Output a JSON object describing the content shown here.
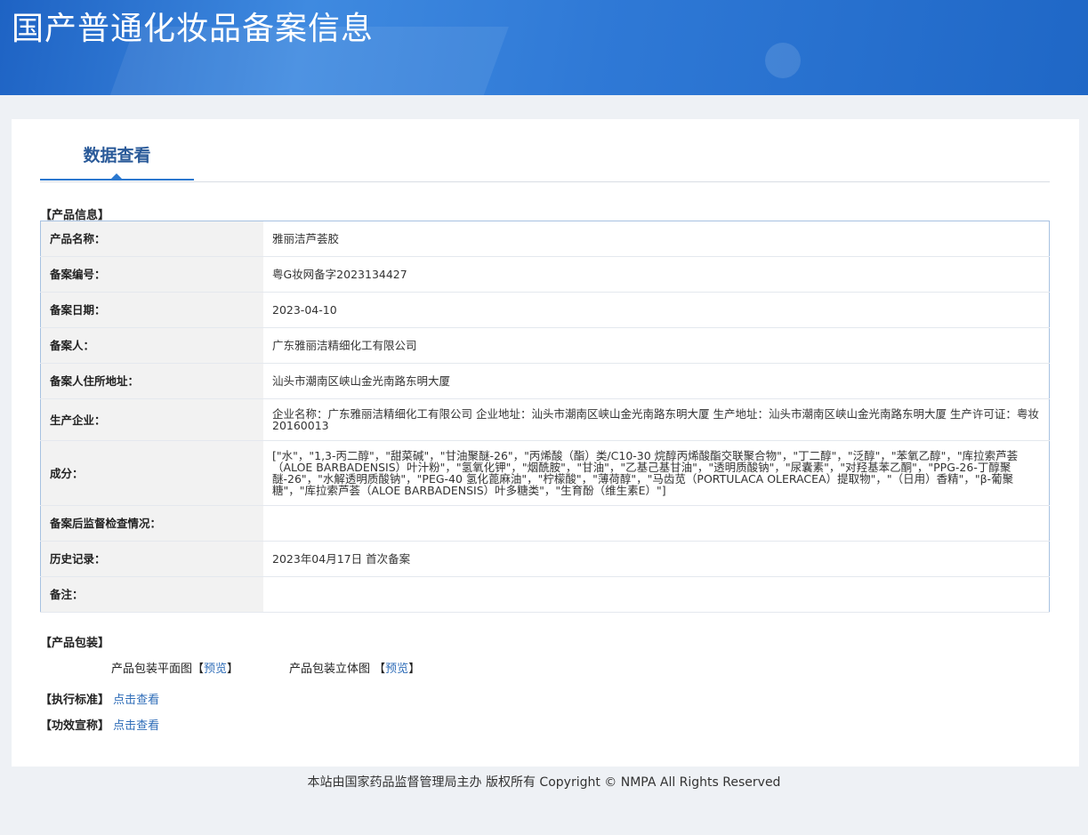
{
  "header": {
    "title": "国产普通化妆品备案信息"
  },
  "tabs": [
    {
      "label": "数据查看"
    }
  ],
  "product_info": {
    "section_title": "【产品信息】",
    "rows": [
      {
        "key": "产品名称：",
        "value": "雅丽洁芦荟胶"
      },
      {
        "key": "备案编号：",
        "value": "粤G妆网备字2023134427"
      },
      {
        "key": "备案日期：",
        "value": "2023-04-10"
      },
      {
        "key": "备案人：",
        "value": "广东雅丽洁精细化工有限公司"
      },
      {
        "key": "备案人住所地址：",
        "value": "汕头市潮南区峡山金光南路东明大厦"
      },
      {
        "key": "生产企业：",
        "value": "企业名称：广东雅丽洁精细化工有限公司 企业地址：汕头市潮南区峡山金光南路东明大厦 生产地址：汕头市潮南区峡山金光南路东明大厦 生产许可证：粤妆20160013"
      },
      {
        "key": "成分：",
        "value": "[\"水\"，\"1,3-丙二醇\"，\"甜菜碱\"，\"甘油聚醚-26\"，\"丙烯酸（酯）类/C10-30 烷醇丙烯酸酯交联聚合物\"，\"丁二醇\"，\"泛醇\"，\"苯氧乙醇\"，\"库拉索芦荟（ALOE BARBADENSIS）叶汁粉\"，\"氢氧化钾\"，\"烟酰胺\"，\"甘油\"，\"乙基己基甘油\"，\"透明质酸钠\"，\"尿囊素\"，\"对羟基苯乙酮\"，\"PPG-26-丁醇聚醚-26\"，\"水解透明质酸钠\"，\"PEG-40 氢化蓖麻油\"，\"柠檬酸\"，\"薄荷醇\"，\"马齿苋（PORTULACA OLERACEA）提取物\"，\"（日用）香精\"，\"β-葡聚糖\"，\"库拉索芦荟（ALOE BARBADENSIS）叶多糖类\"，\"生育酚（维生素E）\"]"
      },
      {
        "key": "备案后监督检查情况：",
        "value": ""
      },
      {
        "key": "历史记录：",
        "value": "2023年04月17日 首次备案"
      },
      {
        "key": "备注：",
        "value": ""
      }
    ]
  },
  "packaging": {
    "section_title": "【产品包装】",
    "flat_label": "产品包装平面图",
    "stereo_label": "产品包装立体图",
    "bracket_open": "【",
    "bracket_close": "】",
    "preview_link": "预览"
  },
  "standard": {
    "label": "【执行标准】",
    "link": "点击查看"
  },
  "efficacy": {
    "label": "【功效宣称】",
    "link": "点击查看"
  },
  "footer": {
    "text": "本站由国家药品监督管理局主办 版权所有 Copyright © NMPA All Rights Reserved"
  }
}
